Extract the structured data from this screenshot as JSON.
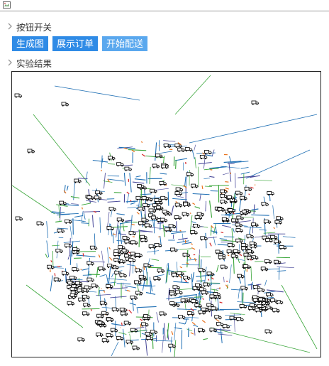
{
  "section_toggle": {
    "label": "按钮开关"
  },
  "buttons": [
    {
      "label": "生成图",
      "emphasis": "primary"
    },
    {
      "label": "展示订单",
      "emphasis": "primary"
    },
    {
      "label": "开始配送",
      "emphasis": "light"
    }
  ],
  "section_results": {
    "label": "实验结果"
  },
  "colors": {
    "button": "#2f8be6",
    "button_light": "#5aa8ee",
    "road_blue": "#1f6fb4",
    "road_green": "#3aa63a",
    "route_orange": "#e8701a",
    "route_red": "#d62728"
  },
  "icons": [
    "broken-image-icon",
    "chevron-right-icon",
    "truck-icon"
  ]
}
